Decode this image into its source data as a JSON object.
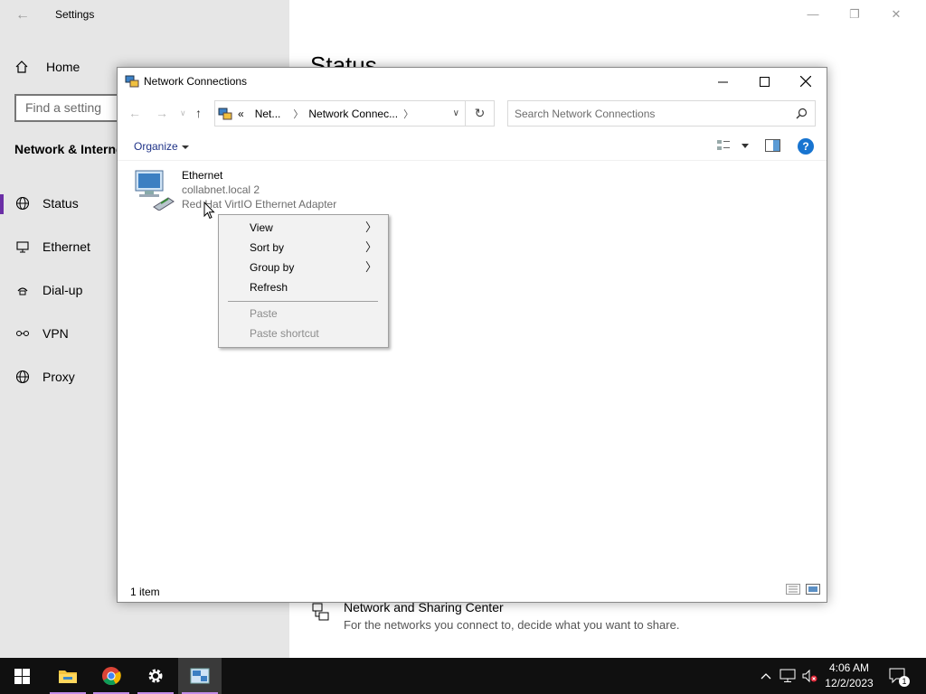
{
  "settings": {
    "title": "Settings",
    "home": "Home",
    "search_placeholder": "Find a setting",
    "section": "Network & Internet",
    "nav": [
      {
        "label": "Status",
        "icon": "globe-icon"
      },
      {
        "label": "Ethernet",
        "icon": "monitor-icon"
      },
      {
        "label": "Dial-up",
        "icon": "phone-icon"
      },
      {
        "label": "VPN",
        "icon": "vpn-icon"
      },
      {
        "label": "Proxy",
        "icon": "globe-icon"
      }
    ],
    "page_title": "Status",
    "sharing_center": {
      "title": "Network and Sharing Center",
      "desc": "For the networks you connect to, decide what you want to share."
    }
  },
  "network_window": {
    "title": "Network Connections",
    "breadcrumb": [
      "«",
      "Net...",
      "Network Connec..."
    ],
    "search_placeholder": "Search Network Connections",
    "organize": "Organize",
    "status": "1 item",
    "connection": {
      "name": "Ethernet",
      "domain": "collabnet.local 2",
      "adapter": "Red Hat VirtIO Ethernet Adapter"
    }
  },
  "context_menu": {
    "items": [
      {
        "label": "View",
        "submenu": true,
        "enabled": true
      },
      {
        "label": "Sort by",
        "submenu": true,
        "enabled": true
      },
      {
        "label": "Group by",
        "submenu": true,
        "enabled": true
      },
      {
        "label": "Refresh",
        "submenu": false,
        "enabled": true
      },
      {
        "label": "Paste",
        "submenu": false,
        "enabled": false
      },
      {
        "label": "Paste shortcut",
        "submenu": false,
        "enabled": false
      }
    ]
  },
  "taskbar": {
    "apps": [
      "start-icon",
      "file-explorer-icon",
      "chrome-icon",
      "settings-icon",
      "network-connections-icon"
    ],
    "time": "4:06 AM",
    "date": "12/2/2023",
    "notification_count": "1"
  },
  "colors": {
    "accent": "#6b2fa6",
    "taskbar": "#101010",
    "settings_sidebar": "#e6e6e6",
    "context_menu": "#f2f2f2"
  }
}
